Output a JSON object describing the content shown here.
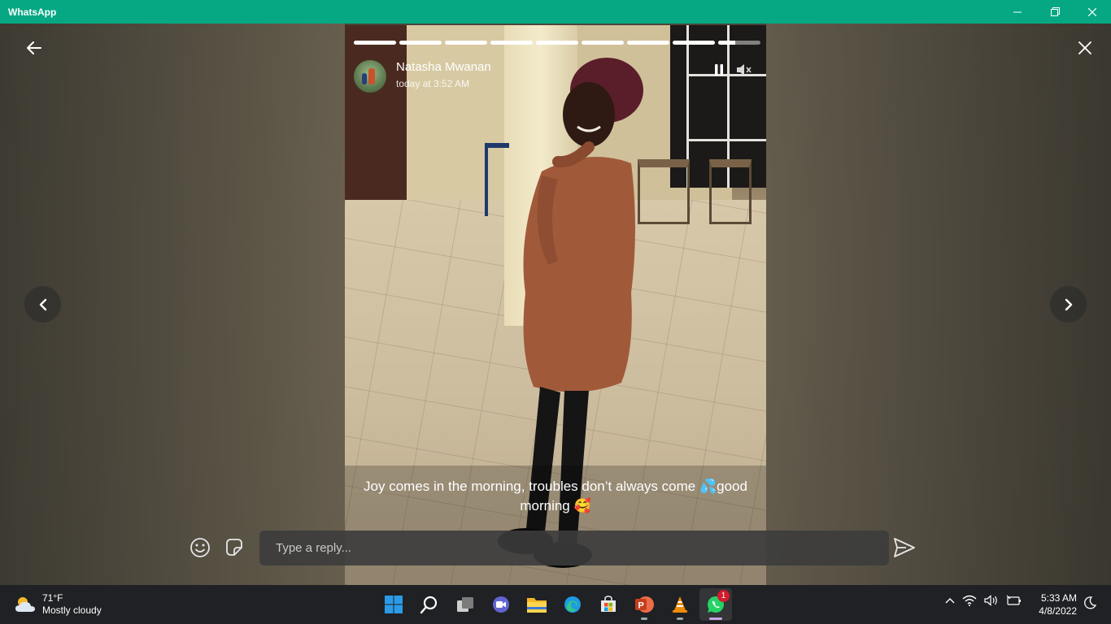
{
  "app": {
    "title": "WhatsApp"
  },
  "status": {
    "contact_name": "Natasha Mwanan",
    "timestamp": "today at 3:52 AM",
    "progress_segments": [
      1,
      1,
      1,
      1,
      1,
      1,
      1,
      1,
      0.4
    ],
    "caption_line1": "Joy comes in the morning, troubles don’t always come 💦good",
    "caption_line2": "morning 🥰"
  },
  "reply": {
    "placeholder": "Type a reply..."
  },
  "taskbar": {
    "weather_temp": "71°F",
    "weather_desc": "Mostly cloudy",
    "time": "5:33 AM",
    "date": "4/8/2022",
    "whatsapp_badge": "1"
  },
  "colors": {
    "titlebar": "#06a884",
    "taskbar": "#1f2124"
  }
}
